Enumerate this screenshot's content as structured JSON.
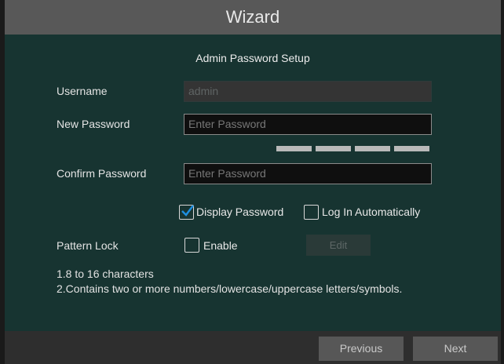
{
  "window": {
    "title": "Wizard"
  },
  "section": {
    "title": "Admin Password Setup"
  },
  "form": {
    "username_label": "Username",
    "username_value": "admin",
    "new_password_label": "New Password",
    "new_password_placeholder": "Enter Password",
    "confirm_password_label": "Confirm Password",
    "confirm_password_placeholder": "Enter Password",
    "display_password_label": "Display Password",
    "display_password_checked": true,
    "auto_login_label": "Log In Automatically",
    "auto_login_checked": false,
    "pattern_lock_label": "Pattern Lock",
    "pattern_enable_label": "Enable",
    "pattern_enable_checked": false,
    "edit_label": "Edit"
  },
  "info": {
    "line1": "1.8 to 16 characters",
    "line2": "2.Contains two or more numbers/lowercase/uppercase letters/symbols."
  },
  "footer": {
    "previous_label": "Previous",
    "next_label": "Next"
  },
  "colors": {
    "content_bg": "#173431",
    "titlebar_bg": "#585858",
    "check_accent": "#1e8fe0"
  }
}
